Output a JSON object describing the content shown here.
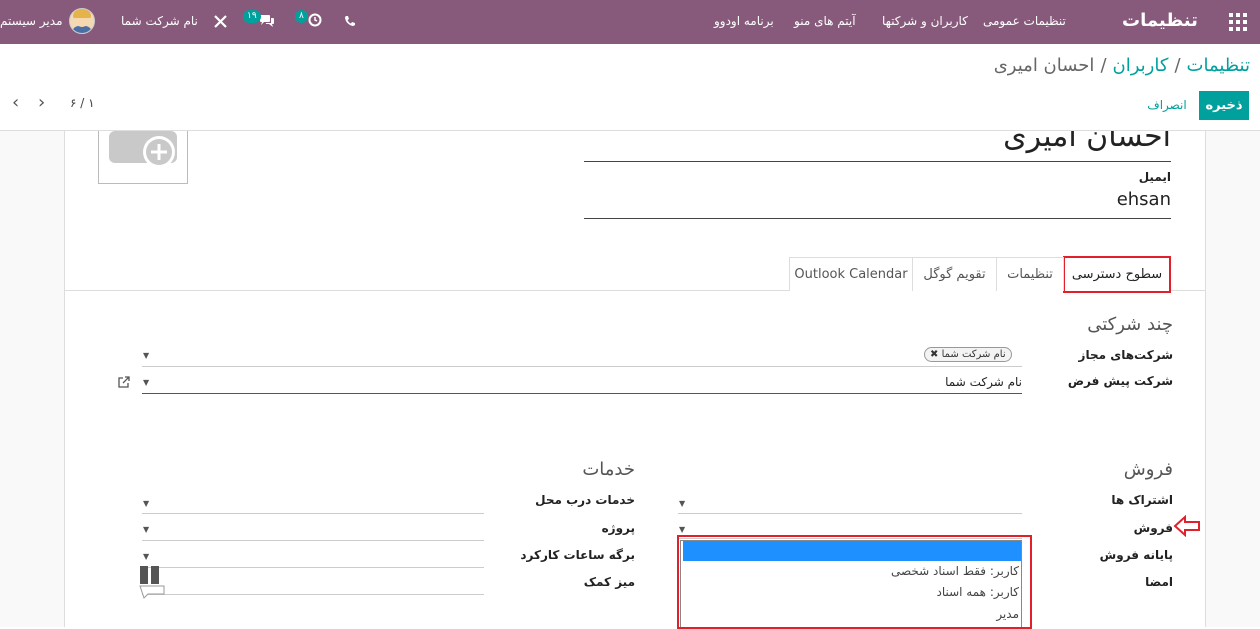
{
  "navbar": {
    "brand": "تنظیمات",
    "menu": [
      "تنظیمات عمومی",
      "کاربران و شرکتها",
      "آیتم های منو",
      "برنامه اودوو"
    ],
    "activity_count": "۸",
    "messages_count": "۱۹",
    "company": "نام شرکت شما",
    "user": "مدیر سیستم"
  },
  "breadcrumb": {
    "root": "تنظیمات",
    "parent": "کاربران",
    "current": "احسان امیری"
  },
  "buttons": {
    "save": "ذخیره",
    "discard": "انصراف"
  },
  "pager": {
    "text": "۶ / ۱"
  },
  "form": {
    "name": "احسان امیری",
    "email_label": "ایمیل",
    "email_value": "ehsan"
  },
  "tabs": [
    "سطوح دسترسی",
    "تنظیمات",
    "تقویم گوگل",
    "Outlook Calendar"
  ],
  "multi_company": {
    "title": "چند شرکتی",
    "allowed_label": "شرکت‌های مجاز",
    "allowed_tag": "نام شرکت شما",
    "default_label": "شرکت پیش فرض",
    "default_value": "نام شرکت شما"
  },
  "sales": {
    "title": "فروش",
    "fields": [
      "اشتراک ها",
      "فروش",
      "پایانه فروش",
      "امضا"
    ]
  },
  "services": {
    "title": "خدمات",
    "fields": [
      "خدمات درب محل",
      "پروژه",
      "برگه ساعات کارکرد",
      "میز کمک"
    ]
  },
  "dropdown": {
    "options": [
      "",
      "کاربر: فقط اسناد شخصی",
      "کاربر: همه اسناد",
      "مدیر"
    ]
  },
  "colors": {
    "navbar": "#875a7b",
    "accent": "#00a09d",
    "highlight": "#e0202a",
    "selected": "#1e90ff"
  }
}
